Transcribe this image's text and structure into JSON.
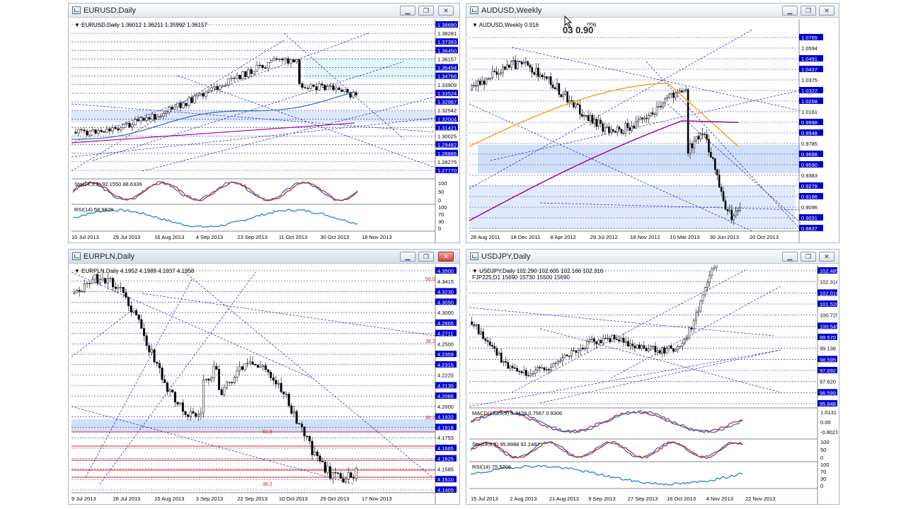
{
  "colors": {
    "axis_tag_blue": "#0000cc",
    "zone_fill": "#c6d8f7",
    "ma_orange": "#f2a516",
    "ma_purple": "#9e0a9e",
    "ma_blue": "#3c74b8",
    "stoch_main": "#1f74c9",
    "stoch_signal": "#d8261e",
    "rsi": "#2b7fd3",
    "dotted_line": "#2020b0"
  },
  "icons": {
    "window": "chart-window-icon",
    "minimize": "minimize-icon",
    "maximize": "maximize-icon",
    "close": "close-icon",
    "cursor": "mouse-pointer-icon"
  },
  "cursor_readout": "03 0.90",
  "windows": {
    "eurusd": {
      "title": "EURUSD,Daily",
      "header": "▼ EURUSD,Daily  1.36012 1.36211 1.35992 1.36157",
      "price_tags": [
        "1.38690",
        "1.38281",
        "1.37393",
        "1.36450",
        "1.36157",
        "1.35494",
        "1.34766",
        "1.33909",
        "1.33524",
        "1.32987",
        "1.32542",
        "1.32004",
        "1.31421",
        "1.30025",
        "1.29482",
        "1.28886",
        "1.28275",
        "1.27770"
      ],
      "dates": [
        "10 Jul 2013",
        "29 Jul 2013",
        "16 Aug 2013",
        "4 Sep 2013",
        "23 Sep 2013",
        "11 Oct 2013",
        "30 Oct 2013",
        "18 Nov 2013"
      ],
      "ind1_label": "Sto(14,3,3) 92.1550 88.6339",
      "ind1_ticks": [
        "100",
        "50",
        "0"
      ],
      "ind2_label": "RSI(14) 58.9829",
      "ind2_ticks": [
        "100",
        "70",
        "30",
        "0"
      ]
    },
    "audusd": {
      "title": "AUDUSD,Weekly",
      "header": "▼ AUDUSD,Weekly  0.916",
      "header_tail": "096",
      "price_tags": [
        "1.0765",
        "1.0594",
        "1.0491",
        "1.0437",
        "1.0375",
        "1.0322",
        "1.0268",
        "1.0161",
        "0.9998",
        "0.9948",
        "0.9785",
        "0.9688",
        "0.9590",
        "0.9383",
        "0.9278",
        "0.9186",
        "0.9096",
        "0.9031",
        "0.8837"
      ],
      "dates": [
        "28 Aug 2011",
        "18 Dec 2011",
        "8 Apr 2012",
        "29 Jul 2012",
        "18 Nov 2012",
        "10 Mar 2013",
        "30 Jun 2013",
        "20 Oct 2013"
      ]
    },
    "eurpln": {
      "title": "EURPLN,Daily",
      "header": "▼ EURPLN,Daily  4.1952 4.1989 4.1937 4.1958",
      "price_tags": [
        "4.3500",
        "4.3415",
        "4.3230",
        "4.3050",
        "4.3000",
        "4.2865",
        "4.2711",
        "4.2500",
        "4.2359",
        "4.2315",
        "4.2225",
        "4.2135",
        "4.2086",
        "4.2000",
        "4.1932",
        "4.1818",
        "4.1753",
        "4.1665",
        "4.1625",
        "4.1585",
        "4.1510",
        "4.1405"
      ],
      "fib_labels": [
        "50.0",
        "38.2",
        "38.2",
        "61.8",
        "38.2"
      ],
      "dates": [
        "9 Jul 2013",
        "28 Jul 2013",
        "15 Aug 2013",
        "3 Sep 2013",
        "22 Sep 2013",
        "10 Oct 2013",
        "29 Oct 2013",
        "17 Nov 2013"
      ]
    },
    "usdjpy": {
      "title": "USDJPY,Daily",
      "header": "▼ USDJPY,Daily  102.290 102.605 102.166 102.316",
      "header2": "FJP225,D1 15690 15730 15500 15690",
      "price_tags": [
        "102.485",
        "102.316",
        "102.016",
        "101.520",
        "100.725",
        "100.545",
        "99.570",
        "99.138",
        "98.595",
        "97.692",
        "97.620",
        "96.599",
        "95.848"
      ],
      "dates": [
        "15 Jul 2013",
        "2 Aug 2013",
        "21 Aug 2013",
        "9 Sep 2013",
        "27 Sep 2013",
        "16 Oct 2013",
        "4 Nov 2013",
        "22 Nov 2013"
      ],
      "ind1_label": "MACD(12,26,9) 0.3438 0.7587 0.9306",
      "ind1_ticks": [
        "1.0131",
        "0.00",
        "-0.8021"
      ],
      "ind2_label": "Sto(14,3,3) 95.8988 92.2487",
      "ind2_ticks": [
        "100",
        "50",
        "0"
      ],
      "ind3_label": "RSI(14) 75.5266",
      "ind3_ticks": [
        "100",
        "70",
        "30",
        "0"
      ]
    }
  }
}
